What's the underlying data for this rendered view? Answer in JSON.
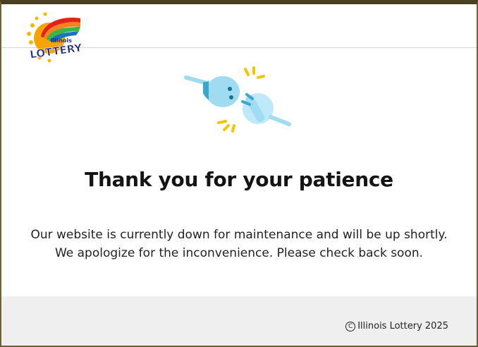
{
  "header": {
    "logo": {
      "icon": "illinois-lottery-logo",
      "text_small": "Illinois",
      "text_large": "LOTTERY"
    }
  },
  "main": {
    "illustration": {
      "icon": "unplugged-plug-icon",
      "colors": {
        "plug": "#9fdcf2",
        "plug_dark": "#37a7cf",
        "spark": "#f5c400"
      }
    },
    "title": "Thank you for your patience",
    "message_line1": "Our website is currently down for maintenance and will be up shortly.",
    "message_line2": "We apologize for the inconvenience. Please check back soon."
  },
  "footer": {
    "copyright_symbol": "C",
    "copyright_text": "Illinois Lottery 2025"
  },
  "colors": {
    "frame_border": "#6e6035",
    "footer_background": "#efefef",
    "title_text": "#141414"
  }
}
